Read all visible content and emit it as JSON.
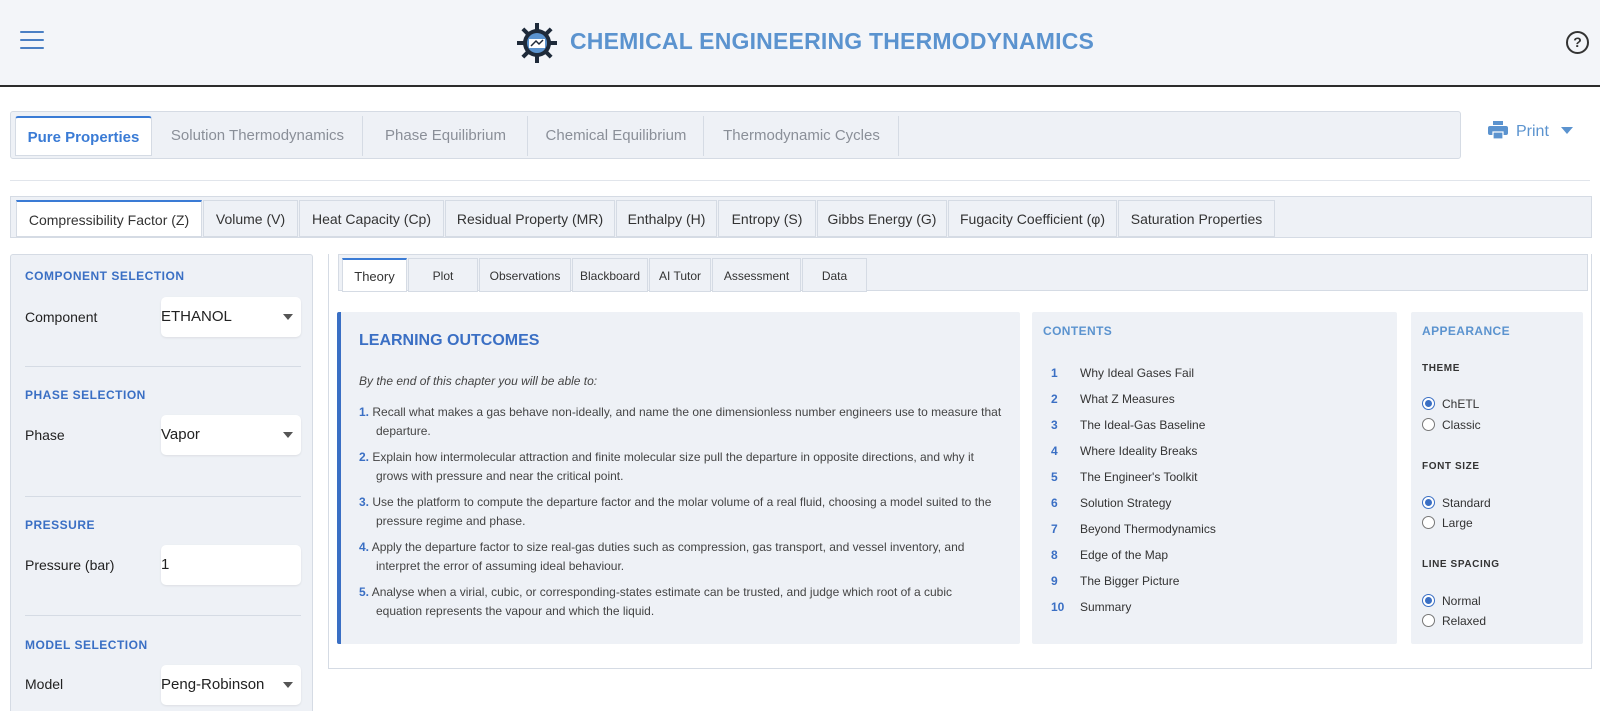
{
  "header": {
    "title": "CHEMICAL ENGINEERING THERMODYNAMICS",
    "menu_icon": "hamburger-menu-icon",
    "logo_icon": "gear-logo-icon",
    "help_icon": "help-icon",
    "help_glyph": "?"
  },
  "main_tabs": [
    "Pure Properties",
    "Solution Thermodynamics",
    "Phase Equilibrium",
    "Chemical Equilibrium",
    "Thermodynamic Cycles"
  ],
  "print": {
    "label": "Print"
  },
  "sub_tabs": [
    "Compressibility Factor (Z)",
    "Volume (V)",
    "Heat Capacity (Cp)",
    "Residual Property (MR)",
    "Enthalpy (H)",
    "Entropy (S)",
    "Gibbs Energy (G)",
    "Fugacity Coefficient (φ)",
    "Saturation Properties"
  ],
  "sidebar": {
    "component": {
      "section": "COMPONENT SELECTION",
      "label": "Component",
      "value": "ETHANOL"
    },
    "phase": {
      "section": "PHASE SELECTION",
      "label": "Phase",
      "value": "Vapor"
    },
    "pressure": {
      "section": "PRESSURE",
      "label": "Pressure (bar)",
      "value": "1"
    },
    "model": {
      "section": "MODEL SELECTION",
      "label": "Model",
      "value": "Peng-Robinson"
    }
  },
  "inner_tabs": [
    "Theory",
    "Plot",
    "Observations",
    "Blackboard",
    "AI Tutor",
    "Assessment",
    "Data"
  ],
  "outcomes": {
    "title": "LEARNING OUTCOMES",
    "intro": "By the end of this chapter you will be able to:",
    "items": [
      {
        "num": "1.",
        "line1": "Recall what makes a gas behave non-ideally, and name the one dimensionless number engineers use to measure that",
        "line2": "departure."
      },
      {
        "num": "2.",
        "line1": "Explain how intermolecular attraction and finite molecular size pull the departure in opposite directions, and why it",
        "line2": "grows with pressure and near the critical point."
      },
      {
        "num": "3.",
        "line1": "Use the platform to compute the departure factor and the molar volume of a real fluid, choosing a model suited to the",
        "line2": "pressure regime and phase."
      },
      {
        "num": "4.",
        "line1": "Apply the departure factor to size real-gas duties such as compression, gas transport, and vessel inventory, and",
        "line2": "interpret the error of assuming ideal behaviour."
      },
      {
        "num": "5.",
        "line1": "Analyse when a virial, cubic, or corresponding-states estimate can be trusted, and judge which root of a cubic",
        "line2": "equation represents the vapour and which the liquid."
      }
    ]
  },
  "contents": {
    "title": "CONTENTS",
    "items": [
      {
        "num": "1",
        "label": "Why Ideal Gases Fail"
      },
      {
        "num": "2",
        "label": "What Z Measures"
      },
      {
        "num": "3",
        "label": "The Ideal-Gas Baseline"
      },
      {
        "num": "4",
        "label": "Where Ideality Breaks"
      },
      {
        "num": "5",
        "label": "The Engineer's Toolkit"
      },
      {
        "num": "6",
        "label": "Solution Strategy"
      },
      {
        "num": "7",
        "label": "Beyond Thermodynamics"
      },
      {
        "num": "8",
        "label": "Edge of the Map"
      },
      {
        "num": "9",
        "label": "The Bigger Picture"
      },
      {
        "num": "10",
        "label": "Summary"
      }
    ]
  },
  "appearance": {
    "title": "APPEARANCE",
    "theme": {
      "label": "THEME",
      "options": [
        "ChETL",
        "Classic"
      ],
      "selected": "ChETL"
    },
    "font_size": {
      "label": "FONT SIZE",
      "options": [
        "Standard",
        "Large"
      ],
      "selected": "Standard"
    },
    "line_spacing": {
      "label": "LINE SPACING",
      "options": [
        "Normal",
        "Relaxed"
      ],
      "selected": "Normal"
    }
  },
  "colors": {
    "accent": "#3a7bd5",
    "title": "#5b93cf",
    "panel": "#eef1f6"
  }
}
